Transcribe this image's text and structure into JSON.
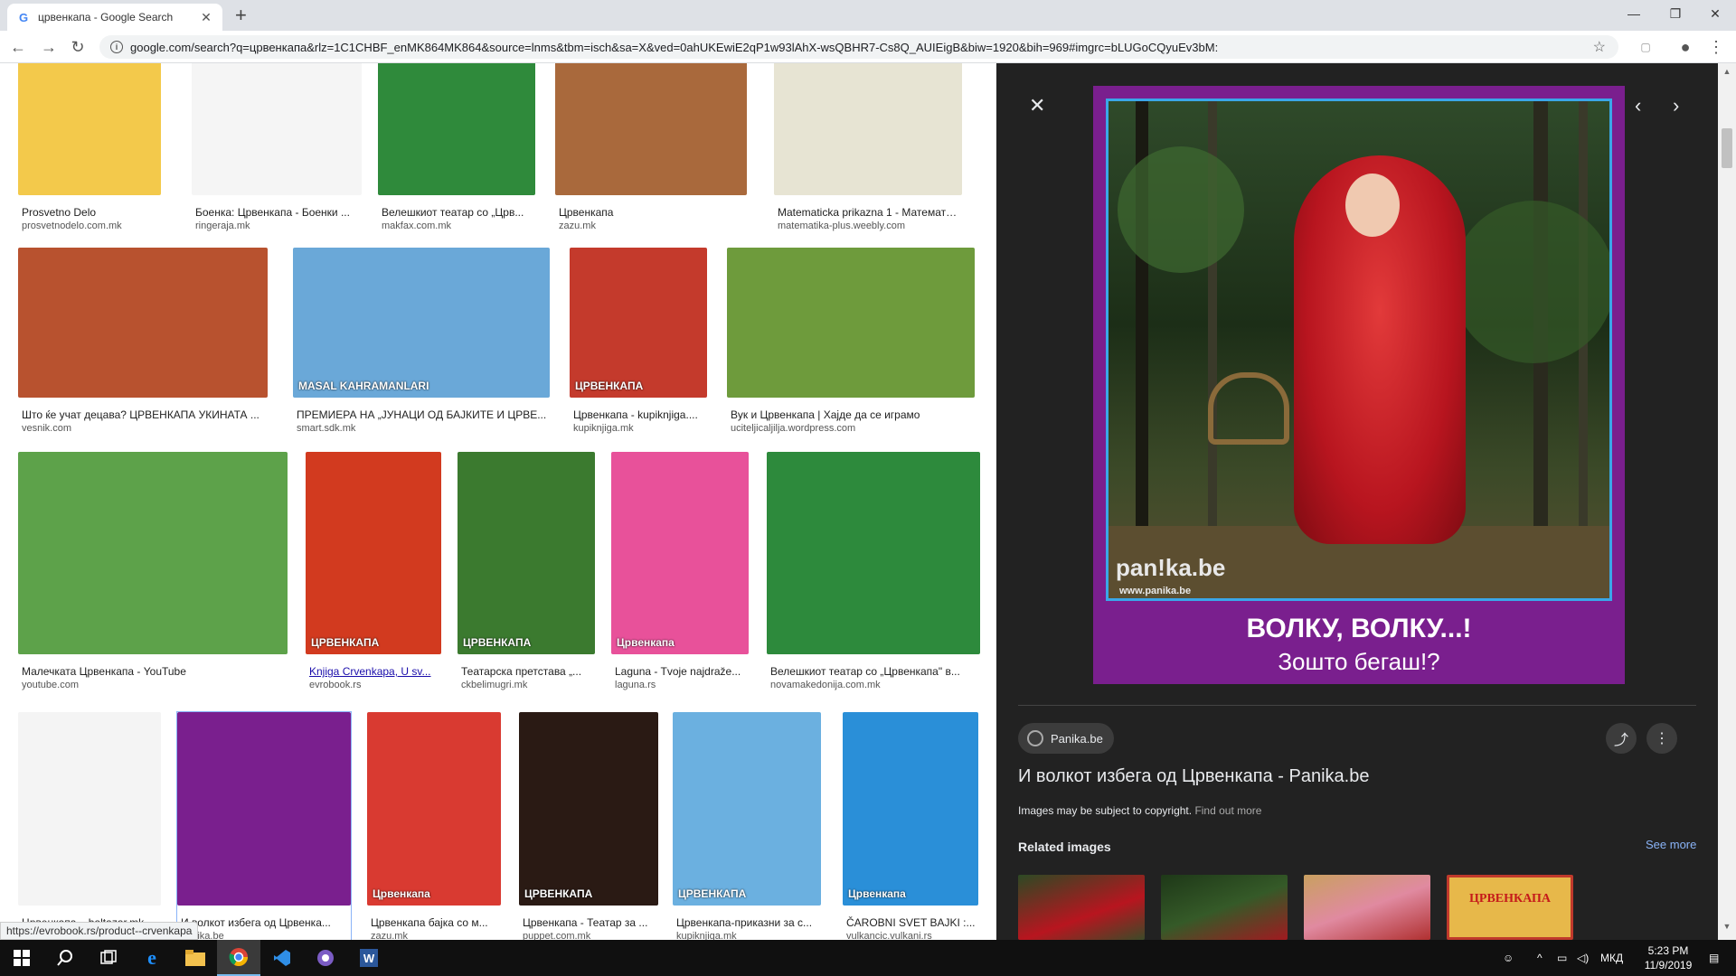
{
  "browser": {
    "tab_title": "црвенкапа - Google Search",
    "tab_favicon": "G",
    "new_tab": "+",
    "url": "google.com/search?q=црвенкапа&rlz=1C1CHBF_enMK864MK864&source=lnms&tbm=isch&sa=X&ved=0ahUKEwiE2qP1w93lAhX-wsQBHR7-Cs8Q_AUIEigB&biw=1920&bih=969#imgrc=bLUGoCQyuEv3bM:",
    "icons": {
      "back": "←",
      "forward": "→",
      "reload": "↻",
      "info": "i",
      "star": "☆",
      "account": "●",
      "menu": "⋮"
    },
    "window_controls": {
      "minimize": "—",
      "maximize": "❐",
      "close": "✕"
    }
  },
  "results": [
    {
      "title": "Prosvetno Delo",
      "source": "prosvetnodelo.com.mk",
      "color": "#f3c94b"
    },
    {
      "title": "Боенка: Црвенкапа - Боенки ...",
      "source": "ringeraja.mk",
      "color": "#f5f5f5"
    },
    {
      "title": "Велешкиот театар со „Црв...",
      "source": "makfax.com.mk",
      "color": "#2f8a3b"
    },
    {
      "title": "Црвенкапа",
      "source": "zazu.mk",
      "color": "#a9693c"
    },
    {
      "title": "Matematicka prikazna 1 - Математик...",
      "source": "matematika-plus.weebly.com",
      "color": "#e7e4d3"
    },
    {
      "title": "Што ќе учат децава? ЦРВЕНКАПА УКИНАТА ...",
      "source": "vesnik.com",
      "color": "#b8522f"
    },
    {
      "title": "ПРЕМИЕРА НА „ЈУНАЦИ ОД БАЈКИТЕ И ЦРВЕ...",
      "source": "smart.sdk.mk",
      "color": "#6aa8d8",
      "overlay": "MASAL KAHRAMANLARI"
    },
    {
      "title": "Црвенкапа - kupiknjiga....",
      "source": "kupiknjiga.mk",
      "color": "#c43a2c",
      "overlay": "ЦРВЕНКАПА"
    },
    {
      "title": "Вук и Црвенкапа | Хајде да се играмо",
      "source": "uciteljicaljilja.wordpress.com",
      "color": "#6e9b3c"
    },
    {
      "title": "Малечката Црвенкапа - YouTube",
      "source": "youtube.com",
      "color": "#5da24a"
    },
    {
      "title": "Knjiga Crvenkapa, U sv...",
      "source": "evrobook.rs",
      "color": "#d23a1f",
      "link": true,
      "overlay": "ЦРВЕНКАПА"
    },
    {
      "title": "Театарска претстава „...",
      "source": "ckbelimugri.mk",
      "color": "#3b7a2f",
      "overlay": "ЦРВЕНКАПА"
    },
    {
      "title": "Laguna - Tvoje najdraže...",
      "source": "laguna.rs",
      "color": "#e8519a",
      "overlay": "Црвенкапа"
    },
    {
      "title": "Велешкиот театар со „Црвенкапа\" в...",
      "source": "novamakedonija.com.mk",
      "color": "#2d8a3c"
    },
    {
      "title": "Црвенкапа – baltazar.mk",
      "source": "baltazar.mk",
      "color": "#f4f4f4"
    },
    {
      "title": "И волкот избега од Црвенка...",
      "source": "panika.be",
      "color": "#7a1f8e",
      "selected": true
    },
    {
      "title": "Црвенкапа бајка со м...",
      "source": "zazu.mk",
      "color": "#d93a31",
      "overlay": "Црвенкапа"
    },
    {
      "title": "Црвенкапа - Театар за ...",
      "source": "puppet.com.mk",
      "color": "#2a1a14",
      "overlay": "ЦРВЕНКАПА"
    },
    {
      "title": "Црвенкапа-приказни за с...",
      "source": "kupiknjiga.mk",
      "color": "#6bb0e0",
      "overlay": "ЦРВЕНКАПА"
    },
    {
      "title": "ČAROBNI SVET BAJKI :...",
      "source": "vulkancic.vulkani.rs",
      "color": "#2a8fd8",
      "overlay": "Црвенкапа"
    }
  ],
  "status_url": "https://evrobook.rs/product--crvenkapa",
  "preview": {
    "watermark": "pan!ka.be",
    "watermark_url": "www.panika.be",
    "caption_line1": "ВОЛКУ, ВОЛКУ...!",
    "caption_line2": "Зошто бегаш!?",
    "source_chip": "Panika.be",
    "title": "И волкот избега од Црвенкапа - Panika.be",
    "copyright": "Images may be subject to copyright.",
    "find_out_more": "Find out more",
    "related_heading": "Related images",
    "see_more": "See more",
    "related_overlay": "ЦРВЕНКАПА",
    "icons": {
      "close": "✕",
      "prev": "‹",
      "next": "›",
      "share": "⤴",
      "more": "⋮"
    }
  },
  "taskbar": {
    "language": "МКД",
    "time": "5:23 PM",
    "date": "11/9/2019"
  }
}
